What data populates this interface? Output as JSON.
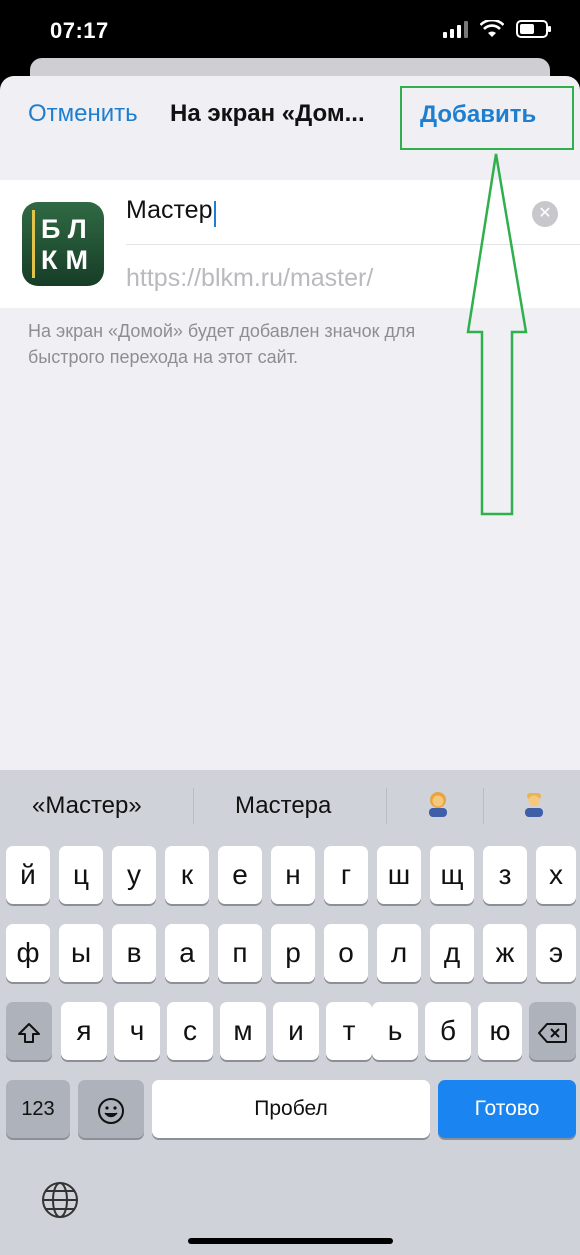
{
  "status_bar": {
    "time": "07:17"
  },
  "nav": {
    "cancel_label": "Отменить",
    "title": "На экран «Дом...",
    "add_label": "Добавить"
  },
  "bookmark": {
    "icon_text_line1": "БЛ",
    "icon_text_line2": "КМ",
    "name_value": "Мастер",
    "url": "https://blkm.ru/master/"
  },
  "description": "На экран «Домой» будет добавлен значок для быстрого перехода на этот сайт.",
  "keyboard": {
    "suggestions": [
      "«Мастер»",
      "Мастера"
    ],
    "row1": [
      "й",
      "ц",
      "у",
      "к",
      "е",
      "н",
      "г",
      "ш",
      "щ",
      "з",
      "х"
    ],
    "row2": [
      "ф",
      "ы",
      "в",
      "а",
      "п",
      "р",
      "о",
      "л",
      "д",
      "ж",
      "э"
    ],
    "row3": [
      "я",
      "ч",
      "с",
      "м",
      "и",
      "т",
      "ь",
      "б",
      "ю"
    ],
    "numbers_label": "123",
    "space_label": "Пробел",
    "done_label": "Готово"
  },
  "colors": {
    "accent": "#1e7ed0",
    "annotation": "#2fb04c",
    "done_key": "#1a84f0"
  }
}
